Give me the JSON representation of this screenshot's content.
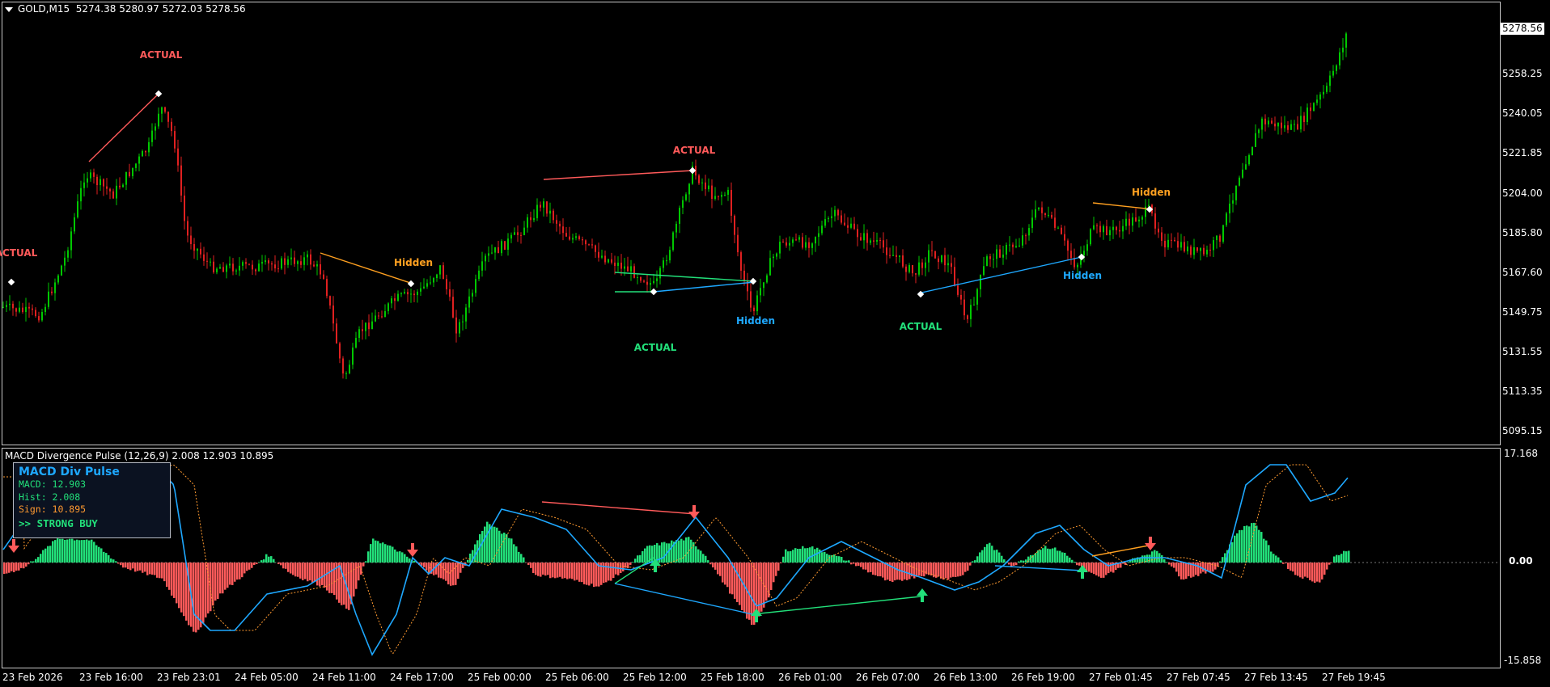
{
  "main_chart": {
    "symbol_tf": "GOLD,M15",
    "ohlc": "5274.38 5280.97 5272.03 5278.56",
    "current_price": "5278.56",
    "price_labels": [
      "5258.25",
      "5240.05",
      "5221.85",
      "5204.00",
      "5185.80",
      "5167.60",
      "5149.75",
      "5131.55",
      "5113.35",
      "5095.15"
    ]
  },
  "macd_pane": {
    "title": "MACD Divergence Pulse (12,26,9) 2.008 12.903 10.895",
    "axis_labels": [
      "17.168",
      "0.00",
      "-15.858"
    ]
  },
  "info_panel": {
    "title": "MACD Div Pulse",
    "macd": "MACD: 12.903",
    "hist": "Hist: 2.008",
    "sign": "Sign: 10.895",
    "signal": ">> STRONG BUY"
  },
  "time_labels": [
    "23 Feb 2026",
    "23 Feb 16:00",
    "23 Feb 23:01",
    "24 Feb 05:00",
    "24 Feb 11:00",
    "24 Feb 17:00",
    "25 Feb 00:00",
    "25 Feb 06:00",
    "25 Feb 12:00",
    "25 Feb 18:00",
    "26 Feb 01:00",
    "26 Feb 07:00",
    "26 Feb 13:00",
    "26 Feb 19:00",
    "27 Feb 01:45",
    "27 Feb 07:45",
    "27 Feb 13:45",
    "27 Feb 19:45"
  ],
  "divergence_labels": [
    {
      "text": "ACTUAL",
      "color": "#ff5a5a"
    },
    {
      "text": "ACTUAL",
      "color": "#ff5a5a"
    },
    {
      "text": "Hidden",
      "color": "#ffa020"
    },
    {
      "text": "ACTUAL",
      "color": "#ff5a5a"
    },
    {
      "text": "ACTUAL",
      "color": "#22e07a"
    },
    {
      "text": "Hidden",
      "color": "#1ea8ff"
    },
    {
      "text": "ACTUAL",
      "color": "#22e07a"
    },
    {
      "text": "Hidden",
      "color": "#1ea8ff"
    },
    {
      "text": "Hidden",
      "color": "#ffa020"
    }
  ],
  "colors": {
    "bull_candle": "#00c800",
    "bear_candle": "#e02020",
    "hist_positive": "#22e07a",
    "hist_negative": "#ff5a5a",
    "macd_line": "#1ea8ff",
    "signal_line": "#ff9a30"
  }
}
